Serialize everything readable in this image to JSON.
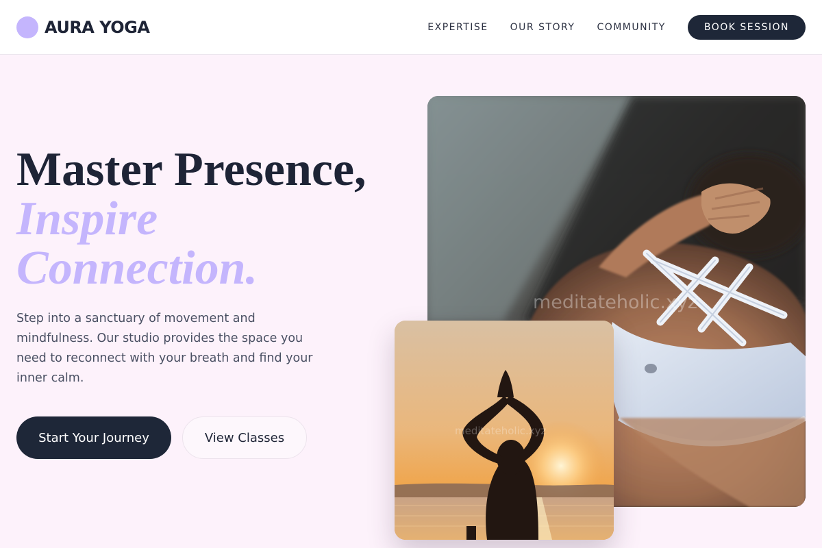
{
  "header": {
    "brand": "AURA YOGA",
    "nav": [
      "EXPERTISE",
      "OUR STORY",
      "COMMUNITY"
    ],
    "cta": "BOOK SESSION"
  },
  "hero": {
    "title_line1": "Master Presence,",
    "title_accent_1": "Inspire",
    "title_accent_2": "Connection.",
    "description": "Step into a sanctuary of movement and mindfulness. Our studio provides the space you need to reconnect with your breath and find your inner calm.",
    "primary_cta": "Start Your Journey",
    "secondary_cta": "View Classes"
  },
  "images": {
    "main_watermark": "meditateholic.xyz",
    "small_watermark": "meditateholic.xyz"
  },
  "colors": {
    "background": "#fdf2fb",
    "accent": "#c4b5fd",
    "dark": "#1e2738"
  }
}
